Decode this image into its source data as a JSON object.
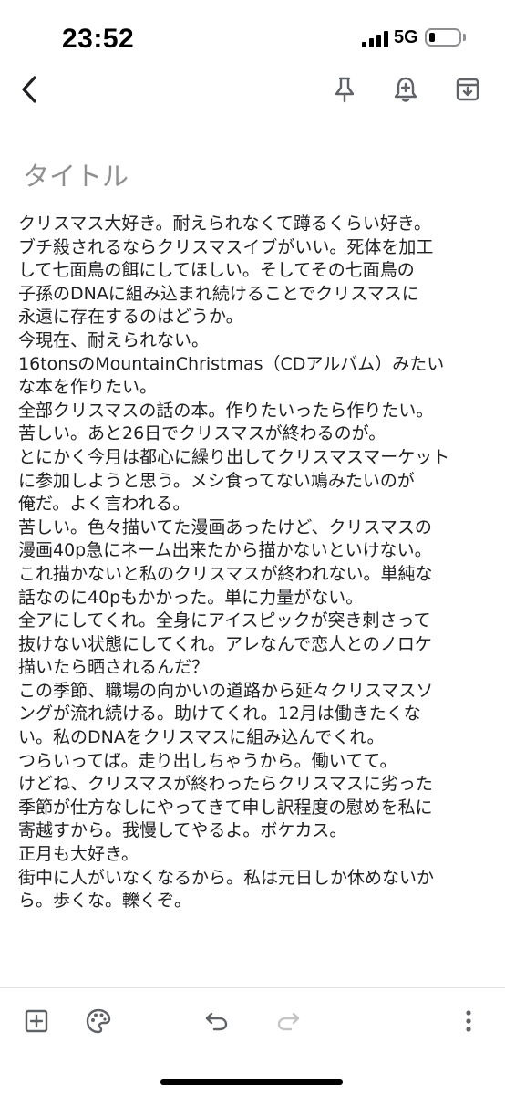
{
  "status_bar": {
    "time": "23:52",
    "network": "5G",
    "signal_bars": 4,
    "battery_level": 0.2
  },
  "toolbar": {
    "back_icon": "chevron-left-icon",
    "pin_icon": "pin-icon",
    "reminder_icon": "bell-plus-icon",
    "archive_icon": "archive-icon"
  },
  "note": {
    "title_placeholder": "タイトル",
    "lines": [
      "クリスマス大好き。耐えられなくて蹲るくらい好き。",
      "ブチ殺されるならクリスマスイブがいい。死体を加工",
      "して七面鳥の餌にしてほしい。そしてその七面鳥の",
      "子孫のDNAに組み込まれ続けることでクリスマスに",
      "永遠に存在するのはどうか。",
      "今現在、耐えられない。",
      "16tonsのMountainChristmas（CDアルバム）みたい",
      "な本を作りたい。",
      "全部クリスマスの話の本。作りたいったら作りたい。",
      "苦しい。あと26日でクリスマスが終わるのが。",
      "とにかく今月は都心に繰り出してクリスマスマーケット",
      "に参加しようと思う。メシ食ってない鳩みたいのが",
      "俺だ。よく言われる。",
      "苦しい。色々描いてた漫画あったけど、クリスマスの",
      "漫画40p急にネーム出来たから描かないといけない。",
      "これ描かないと私のクリスマスが終われない。単純な",
      "話なのに40pもかかった。単に力量がない。",
      "全アにしてくれ。全身にアイスピックが突き刺さって",
      "抜けない状態にしてくれ。アレなんで恋人とのノロケ",
      "描いたら晒されるんだ？",
      "この季節、職場の向かいの道路から延々クリスマスソ",
      "ングが流れ続ける。助けてくれ。12月は働きたくな",
      "い。私のDNAをクリスマスに組み込んでくれ。",
      "つらいってば。走り出しちゃうから。働いてて。",
      "けどね、クリスマスが終わったらクリスマスに劣った",
      "季節が仕方なしにやってきて申し訳程度の慰めを私に",
      "寄越すから。我慢してやるよ。ボケカス。",
      "正月も大好き。",
      "街中に人がいなくなるから。私は元日しか休めないか",
      "ら。歩くな。轢くぞ。"
    ]
  },
  "bottom_bar": {
    "add_icon": "add-box-icon",
    "palette_icon": "palette-icon",
    "undo_icon": "undo-icon",
    "redo_icon": "redo-icon",
    "more_icon": "more-vertical-icon"
  },
  "colors": {
    "text": "#202124",
    "placeholder": "#8f8f8f",
    "icon": "#5f6368",
    "disabled_icon": "#c4c4c4"
  }
}
